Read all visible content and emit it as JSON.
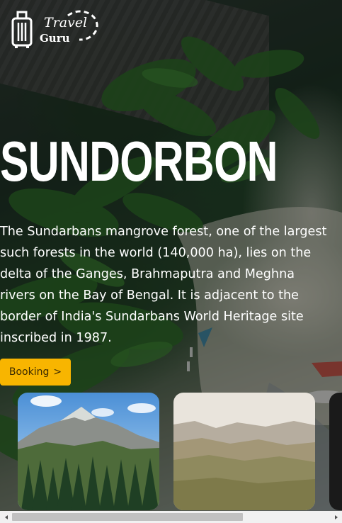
{
  "logo": {
    "line1": "Travel",
    "line2": "Guru",
    "icon": "suitcase-icon"
  },
  "hero": {
    "title": "SUNDORBON",
    "description": "The Sundarbans mangrove forest, one of the largest such forests in the world (140,000 ha), lies on the delta of the Ganges, Brahmaputra and Meghna rivers on the Bay of Bengal. It is adjacent to the border of India's Sundarbans World Heritage site inscribed in 1987."
  },
  "booking_button": {
    "label": "Booking",
    "icon": "chevron-right-icon",
    "color": "#f8b500"
  },
  "cards": [
    {
      "image": "mountain-forest-photo"
    },
    {
      "image": "hazy-valley-photo"
    },
    {
      "image": "dark-photo"
    }
  ],
  "scrollbar": {
    "orientation": "horizontal",
    "position_fraction": 0.0,
    "visible_fraction": 0.72
  }
}
